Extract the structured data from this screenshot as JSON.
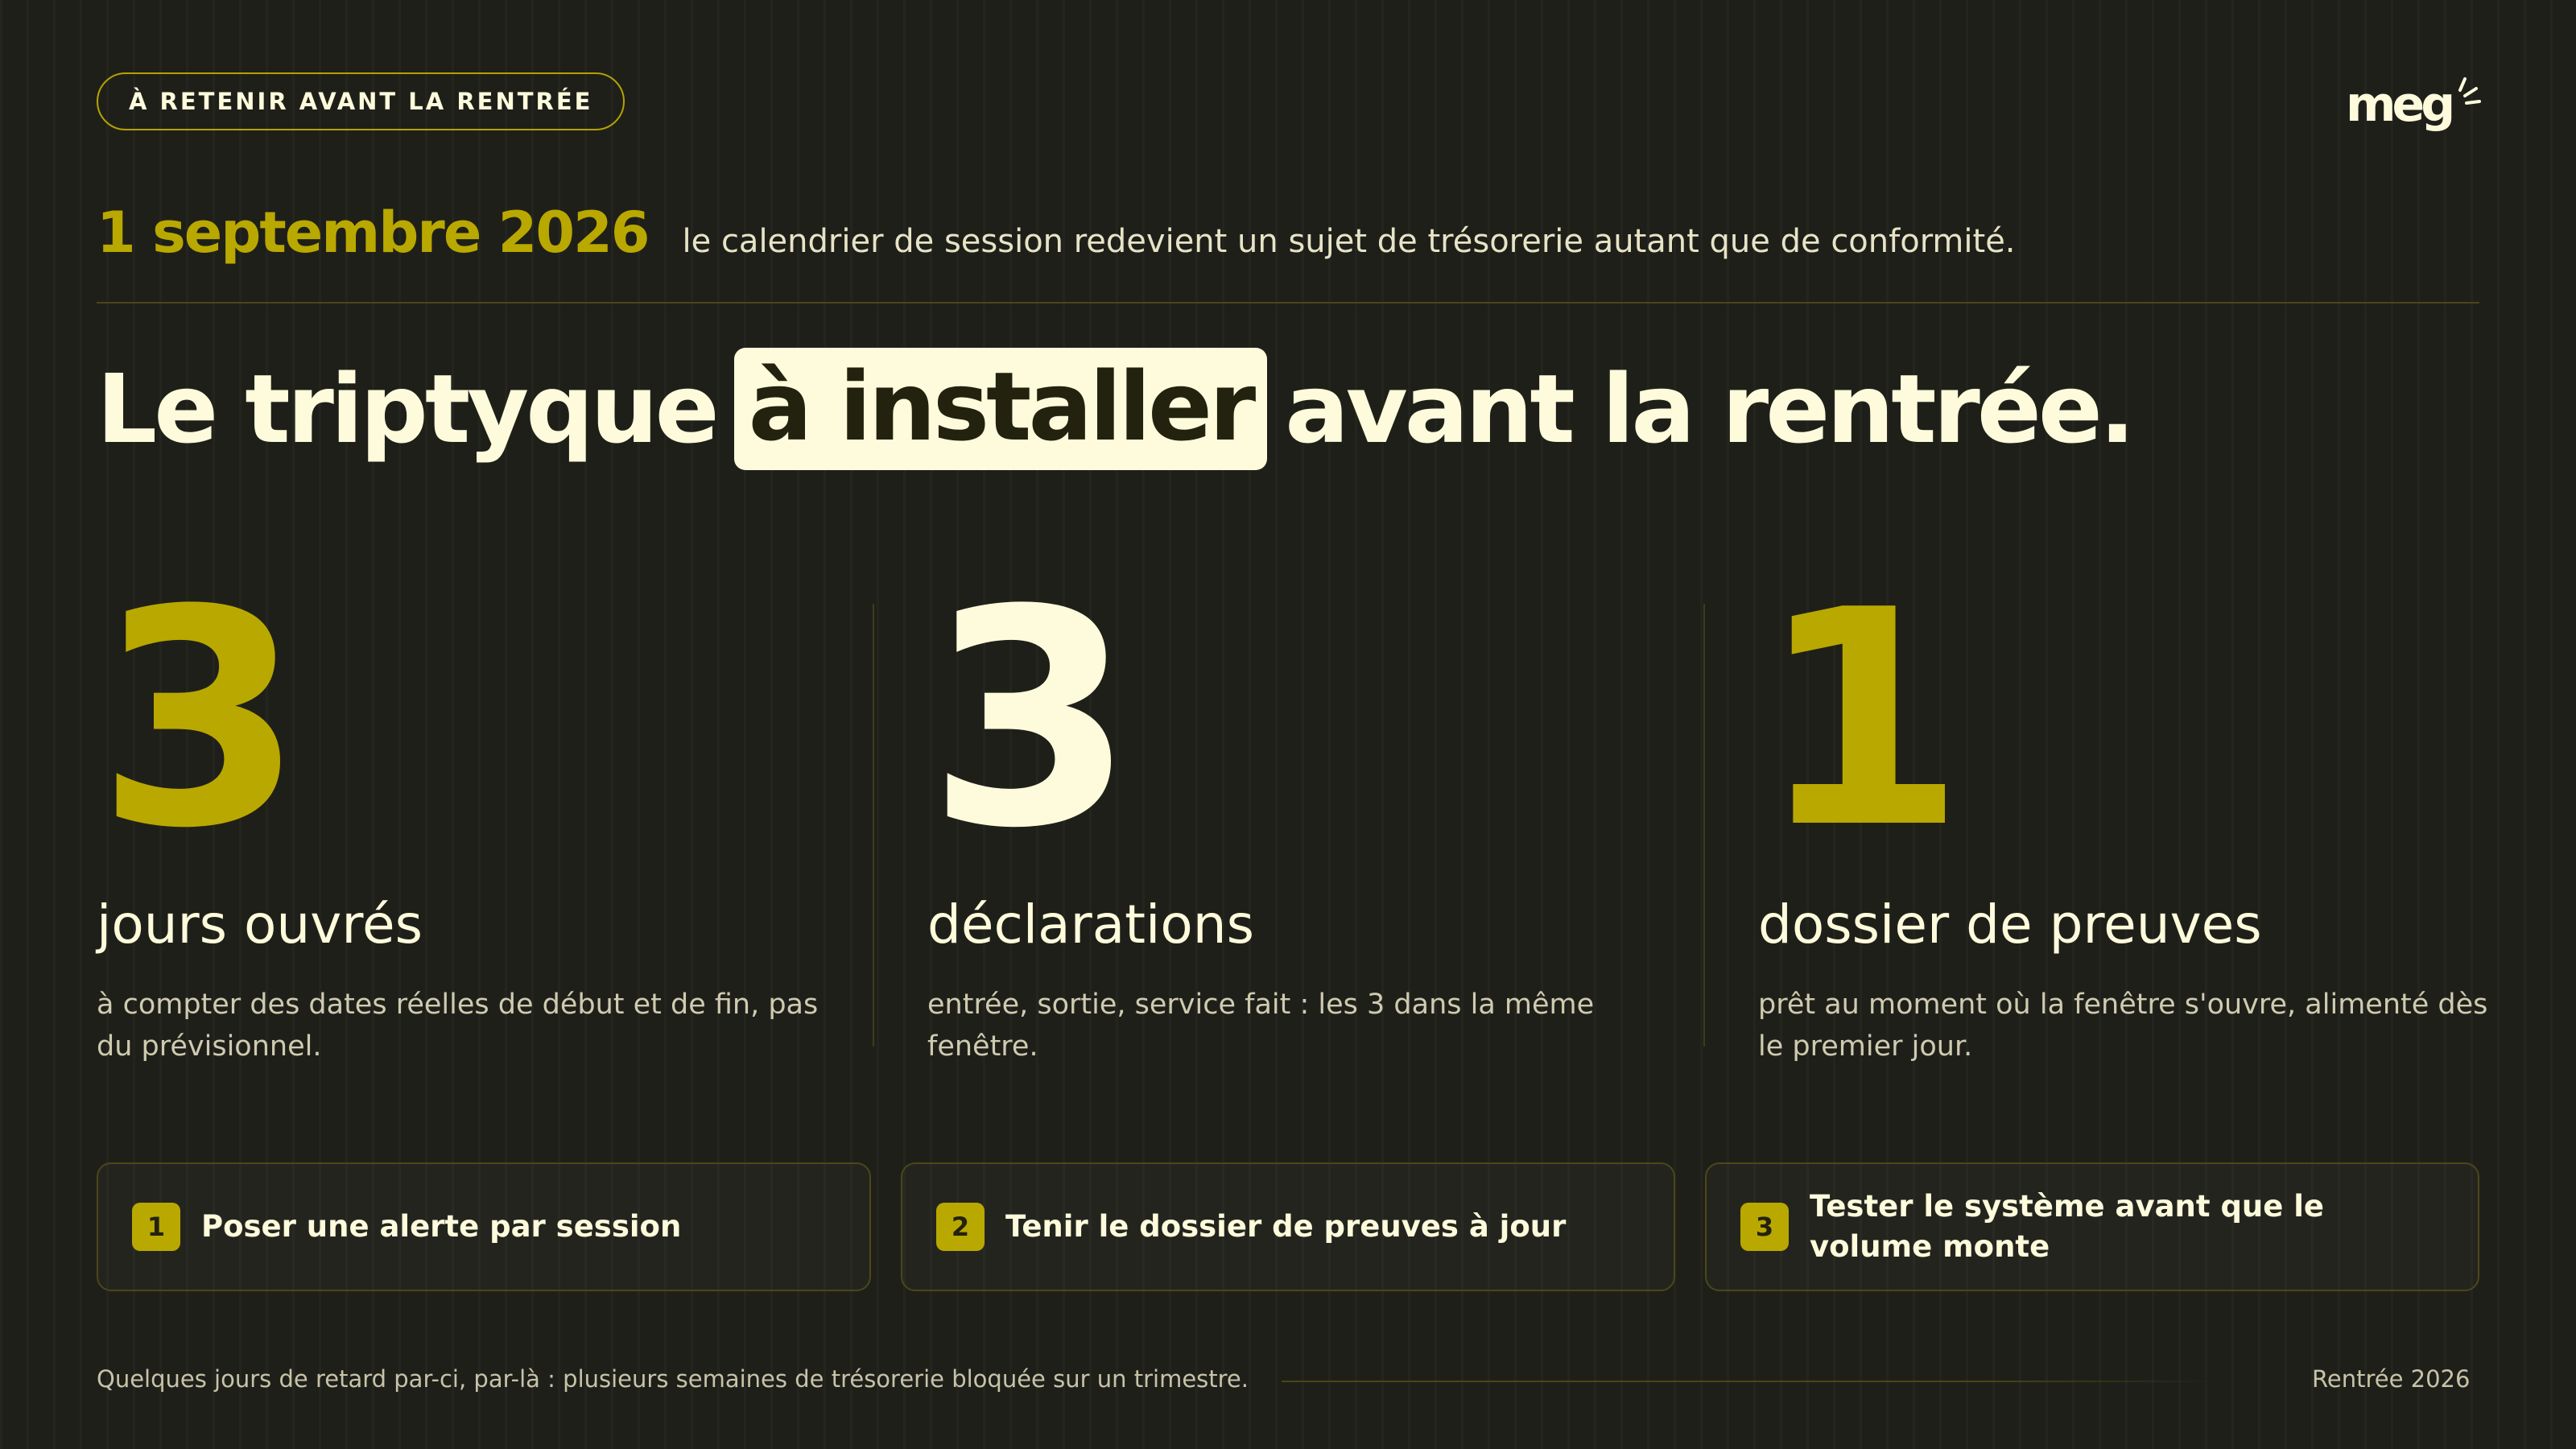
{
  "badge": "À RETENIR AVANT LA RENTRÉE",
  "logo": {
    "text": "meg",
    "color": "#fdfbdb"
  },
  "date": "1 septembre 2026",
  "date_desc": "le calendrier de session redevient un sujet de trésorerie autant que de conformité.",
  "headline": {
    "before": "Le triptyque",
    "highlight": "à installer",
    "after": "avant la rentrée."
  },
  "stats": [
    {
      "number": "3",
      "label": "jours ouvrés",
      "desc": "à compter des dates réelles de début et de fin, pas du prévisionnel.",
      "color": "#b9a800"
    },
    {
      "number": "3",
      "label": "déclarations",
      "desc": "entrée, sortie, service fait : les 3 dans la même fenêtre.",
      "color": "#fdfbdb"
    },
    {
      "number": "1",
      "label": "dossier de preuves",
      "desc": "prêt au moment où la fenêtre s'ouvre, alimenté dès le premier jour.",
      "color": "#b9a800"
    }
  ],
  "steps": [
    {
      "n": "1",
      "text": "Poser une alerte par session"
    },
    {
      "n": "2",
      "text": "Tenir le dossier de preuves à jour"
    },
    {
      "n": "3",
      "text": "Tester le système avant que le volume monte"
    }
  ],
  "footer": {
    "left": "Quelques jours de retard par-ci, par-là : plusieurs semaines de trésorerie bloquée sur un trimestre.",
    "right": "Rentrée 2026"
  },
  "colors": {
    "background": "#1f1f1a",
    "accent": "#b9a800",
    "text": "#fdfbdb"
  }
}
